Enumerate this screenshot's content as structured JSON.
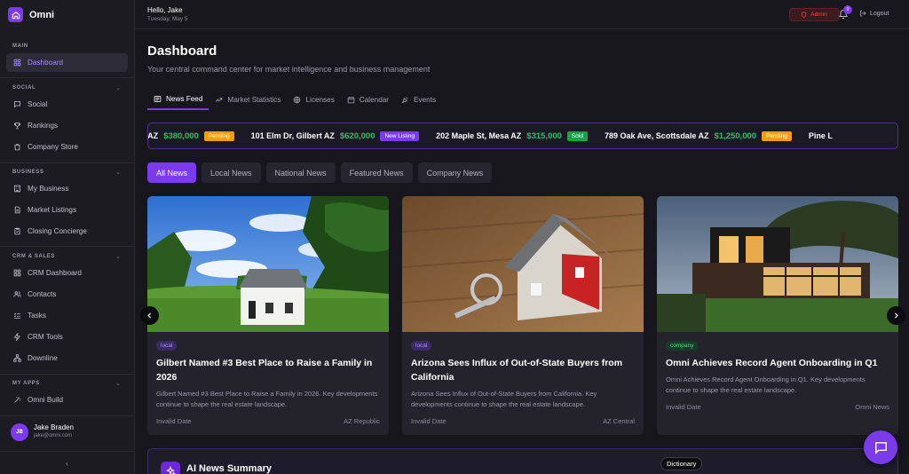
{
  "brand": {
    "name": "Omni"
  },
  "sidebar": {
    "sections": {
      "main": "MAIN",
      "social": "SOCIAL",
      "business": "BUSINESS",
      "crm": "CRM & SALES",
      "apps": "MY APPS"
    },
    "items": {
      "dashboard": "Dashboard",
      "social": "Social",
      "rankings": "Rankings",
      "company_store": "Company Store",
      "my_business": "My Business",
      "market_listings": "Market Listings",
      "closing_concierge": "Closing Concierge",
      "crm_dashboard": "CRM Dashboard",
      "contacts": "Contacts",
      "tasks": "Tasks",
      "crm_tools": "CRM Tools",
      "downline": "Downline",
      "omni_build": "Omni Build"
    },
    "user": {
      "initials": "JB",
      "name": "Jake Braden",
      "email": "jake@omni.com"
    },
    "collapse": "‹"
  },
  "topbar": {
    "greeting": "Hello, Jake",
    "date": "Tuesday, May 5",
    "admin": "Admin",
    "notifications": "9",
    "logout": "Logout"
  },
  "main": {
    "title": "Dashboard",
    "subtitle": "Your central command center for market intelligence and business management",
    "tabs": {
      "news": "News Feed",
      "stats": "Market Statistics",
      "licenses": "Licenses",
      "calendar": "Calendar",
      "events": "Events"
    },
    "ticker": [
      {
        "address": "e AZ",
        "price": "$380,000",
        "status": "Pending",
        "color": "#f59e0b"
      },
      {
        "address": "101 Elm Dr, Gilbert AZ",
        "price": "$620,000",
        "status": "New Listing",
        "color": "#7c3aed"
      },
      {
        "address": "202 Maple St, Mesa AZ",
        "price": "$315,000",
        "status": "Sold",
        "color": "#16a34a"
      },
      {
        "address": "789 Oak Ave, Scottsdale AZ",
        "price": "$1,250,000",
        "status": "Pending",
        "color": "#f59e0b"
      },
      {
        "address": "Pine L",
        "price": "",
        "status": "",
        "color": ""
      }
    ],
    "filters": {
      "all": "All News",
      "local": "Local News",
      "national": "National News",
      "featured": "Featured News",
      "company": "Company News"
    },
    "cards": [
      {
        "tag": "local",
        "title": "Gilbert Named #3 Best Place to Raise a Family in 2026",
        "text": "Gilbert Named #3 Best Place to Raise a Family in 2026. Key developments continue to shape the real estate landscape.",
        "date": "Invalid Date",
        "source": "AZ Republic"
      },
      {
        "tag": "local",
        "title": "Arizona Sees Influx of Out-of-State Buyers from California",
        "text": "Arizona Sees Influx of Out-of-State Buyers from California. Key developments continue to shape the real estate landscape.",
        "date": "Invalid Date",
        "source": "AZ Central"
      },
      {
        "tag": "company",
        "title": "Omni Achieves Record Agent Onboarding in Q1",
        "text": "Omni Achieves Record Agent Onboarding in Q1. Key developments continue to shape the real estate landscape.",
        "date": "Invalid Date",
        "source": "Omni News"
      }
    ],
    "summary_title": "AI News Summary",
    "dictionary": "Dictionary"
  },
  "colors": {
    "accent": "#7c3aed",
    "success": "#22c55e",
    "warning": "#f59e0b",
    "danger": "#ef4444"
  }
}
